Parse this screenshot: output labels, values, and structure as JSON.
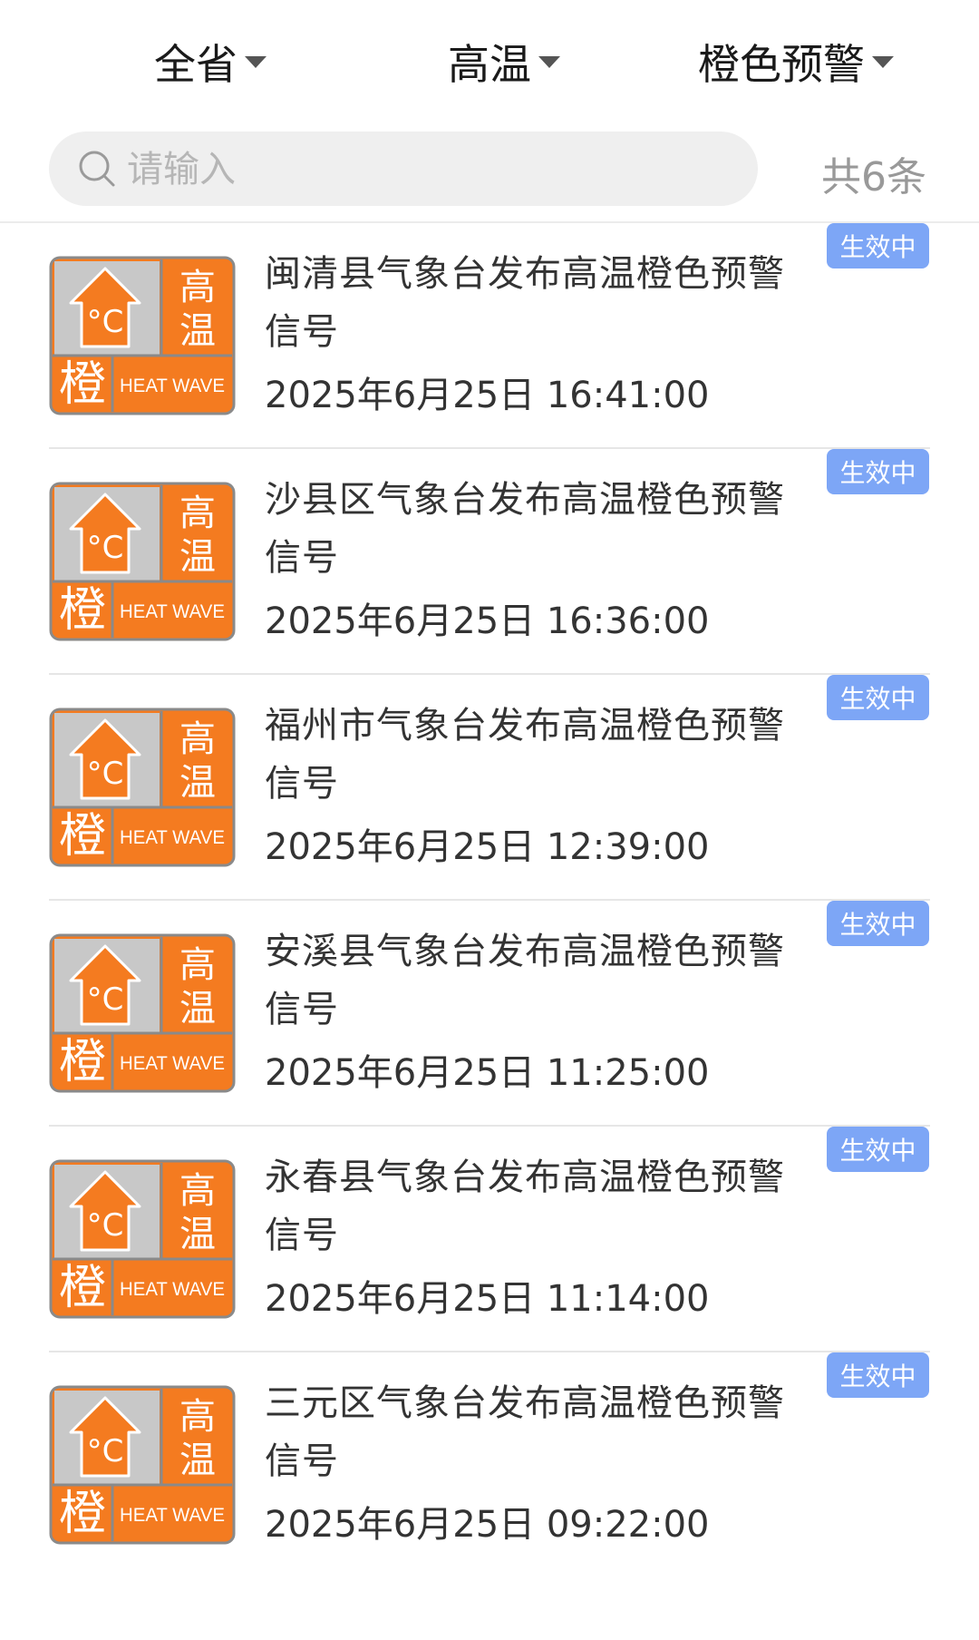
{
  "filters": [
    {
      "label": "全省"
    },
    {
      "label": "高温"
    },
    {
      "label": "橙色预警"
    }
  ],
  "search": {
    "placeholder": "请输入"
  },
  "count_text": "共6条",
  "icon_texts": {
    "char_top": "高",
    "char_mid": "温",
    "level": "橙",
    "english": "HEAT WAVE",
    "unit": "°C"
  },
  "colors": {
    "warning_orange": "#f47b20",
    "badge_gray": "#c8c8c8",
    "status_blue": "#7da6f6"
  },
  "warnings": [
    {
      "title": "闽清县气象台发布高温橙色预警信号",
      "time": "2025年6月25日 16:41:00",
      "status": "生效中"
    },
    {
      "title": "沙县区气象台发布高温橙色预警信号",
      "time": "2025年6月25日 16:36:00",
      "status": "生效中"
    },
    {
      "title": "福州市气象台发布高温橙色预警信号",
      "time": "2025年6月25日 12:39:00",
      "status": "生效中"
    },
    {
      "title": "安溪县气象台发布高温橙色预警信号",
      "time": "2025年6月25日 11:25:00",
      "status": "生效中"
    },
    {
      "title": "永春县气象台发布高温橙色预警信号",
      "time": "2025年6月25日 11:14:00",
      "status": "生效中"
    },
    {
      "title": "三元区气象台发布高温橙色预警信号",
      "time": "2025年6月25日 09:22:00",
      "status": "生效中"
    }
  ]
}
